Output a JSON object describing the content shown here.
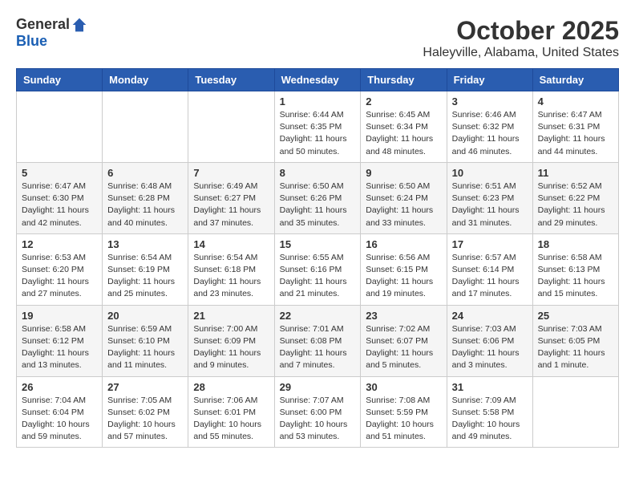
{
  "header": {
    "logo": {
      "general": "General",
      "blue": "Blue"
    },
    "title": "October 2025",
    "location": "Haleyville, Alabama, United States"
  },
  "weekdays": [
    "Sunday",
    "Monday",
    "Tuesday",
    "Wednesday",
    "Thursday",
    "Friday",
    "Saturday"
  ],
  "weeks": [
    [
      {
        "day": "",
        "sunrise": "",
        "sunset": "",
        "daylight": ""
      },
      {
        "day": "",
        "sunrise": "",
        "sunset": "",
        "daylight": ""
      },
      {
        "day": "",
        "sunrise": "",
        "sunset": "",
        "daylight": ""
      },
      {
        "day": "1",
        "sunrise": "Sunrise: 6:44 AM",
        "sunset": "Sunset: 6:35 PM",
        "daylight": "Daylight: 11 hours and 50 minutes."
      },
      {
        "day": "2",
        "sunrise": "Sunrise: 6:45 AM",
        "sunset": "Sunset: 6:34 PM",
        "daylight": "Daylight: 11 hours and 48 minutes."
      },
      {
        "day": "3",
        "sunrise": "Sunrise: 6:46 AM",
        "sunset": "Sunset: 6:32 PM",
        "daylight": "Daylight: 11 hours and 46 minutes."
      },
      {
        "day": "4",
        "sunrise": "Sunrise: 6:47 AM",
        "sunset": "Sunset: 6:31 PM",
        "daylight": "Daylight: 11 hours and 44 minutes."
      }
    ],
    [
      {
        "day": "5",
        "sunrise": "Sunrise: 6:47 AM",
        "sunset": "Sunset: 6:30 PM",
        "daylight": "Daylight: 11 hours and 42 minutes."
      },
      {
        "day": "6",
        "sunrise": "Sunrise: 6:48 AM",
        "sunset": "Sunset: 6:28 PM",
        "daylight": "Daylight: 11 hours and 40 minutes."
      },
      {
        "day": "7",
        "sunrise": "Sunrise: 6:49 AM",
        "sunset": "Sunset: 6:27 PM",
        "daylight": "Daylight: 11 hours and 37 minutes."
      },
      {
        "day": "8",
        "sunrise": "Sunrise: 6:50 AM",
        "sunset": "Sunset: 6:26 PM",
        "daylight": "Daylight: 11 hours and 35 minutes."
      },
      {
        "day": "9",
        "sunrise": "Sunrise: 6:50 AM",
        "sunset": "Sunset: 6:24 PM",
        "daylight": "Daylight: 11 hours and 33 minutes."
      },
      {
        "day": "10",
        "sunrise": "Sunrise: 6:51 AM",
        "sunset": "Sunset: 6:23 PM",
        "daylight": "Daylight: 11 hours and 31 minutes."
      },
      {
        "day": "11",
        "sunrise": "Sunrise: 6:52 AM",
        "sunset": "Sunset: 6:22 PM",
        "daylight": "Daylight: 11 hours and 29 minutes."
      }
    ],
    [
      {
        "day": "12",
        "sunrise": "Sunrise: 6:53 AM",
        "sunset": "Sunset: 6:20 PM",
        "daylight": "Daylight: 11 hours and 27 minutes."
      },
      {
        "day": "13",
        "sunrise": "Sunrise: 6:54 AM",
        "sunset": "Sunset: 6:19 PM",
        "daylight": "Daylight: 11 hours and 25 minutes."
      },
      {
        "day": "14",
        "sunrise": "Sunrise: 6:54 AM",
        "sunset": "Sunset: 6:18 PM",
        "daylight": "Daylight: 11 hours and 23 minutes."
      },
      {
        "day": "15",
        "sunrise": "Sunrise: 6:55 AM",
        "sunset": "Sunset: 6:16 PM",
        "daylight": "Daylight: 11 hours and 21 minutes."
      },
      {
        "day": "16",
        "sunrise": "Sunrise: 6:56 AM",
        "sunset": "Sunset: 6:15 PM",
        "daylight": "Daylight: 11 hours and 19 minutes."
      },
      {
        "day": "17",
        "sunrise": "Sunrise: 6:57 AM",
        "sunset": "Sunset: 6:14 PM",
        "daylight": "Daylight: 11 hours and 17 minutes."
      },
      {
        "day": "18",
        "sunrise": "Sunrise: 6:58 AM",
        "sunset": "Sunset: 6:13 PM",
        "daylight": "Daylight: 11 hours and 15 minutes."
      }
    ],
    [
      {
        "day": "19",
        "sunrise": "Sunrise: 6:58 AM",
        "sunset": "Sunset: 6:12 PM",
        "daylight": "Daylight: 11 hours and 13 minutes."
      },
      {
        "day": "20",
        "sunrise": "Sunrise: 6:59 AM",
        "sunset": "Sunset: 6:10 PM",
        "daylight": "Daylight: 11 hours and 11 minutes."
      },
      {
        "day": "21",
        "sunrise": "Sunrise: 7:00 AM",
        "sunset": "Sunset: 6:09 PM",
        "daylight": "Daylight: 11 hours and 9 minutes."
      },
      {
        "day": "22",
        "sunrise": "Sunrise: 7:01 AM",
        "sunset": "Sunset: 6:08 PM",
        "daylight": "Daylight: 11 hours and 7 minutes."
      },
      {
        "day": "23",
        "sunrise": "Sunrise: 7:02 AM",
        "sunset": "Sunset: 6:07 PM",
        "daylight": "Daylight: 11 hours and 5 minutes."
      },
      {
        "day": "24",
        "sunrise": "Sunrise: 7:03 AM",
        "sunset": "Sunset: 6:06 PM",
        "daylight": "Daylight: 11 hours and 3 minutes."
      },
      {
        "day": "25",
        "sunrise": "Sunrise: 7:03 AM",
        "sunset": "Sunset: 6:05 PM",
        "daylight": "Daylight: 11 hours and 1 minute."
      }
    ],
    [
      {
        "day": "26",
        "sunrise": "Sunrise: 7:04 AM",
        "sunset": "Sunset: 6:04 PM",
        "daylight": "Daylight: 10 hours and 59 minutes."
      },
      {
        "day": "27",
        "sunrise": "Sunrise: 7:05 AM",
        "sunset": "Sunset: 6:02 PM",
        "daylight": "Daylight: 10 hours and 57 minutes."
      },
      {
        "day": "28",
        "sunrise": "Sunrise: 7:06 AM",
        "sunset": "Sunset: 6:01 PM",
        "daylight": "Daylight: 10 hours and 55 minutes."
      },
      {
        "day": "29",
        "sunrise": "Sunrise: 7:07 AM",
        "sunset": "Sunset: 6:00 PM",
        "daylight": "Daylight: 10 hours and 53 minutes."
      },
      {
        "day": "30",
        "sunrise": "Sunrise: 7:08 AM",
        "sunset": "Sunset: 5:59 PM",
        "daylight": "Daylight: 10 hours and 51 minutes."
      },
      {
        "day": "31",
        "sunrise": "Sunrise: 7:09 AM",
        "sunset": "Sunset: 5:58 PM",
        "daylight": "Daylight: 10 hours and 49 minutes."
      },
      {
        "day": "",
        "sunrise": "",
        "sunset": "",
        "daylight": ""
      }
    ]
  ]
}
